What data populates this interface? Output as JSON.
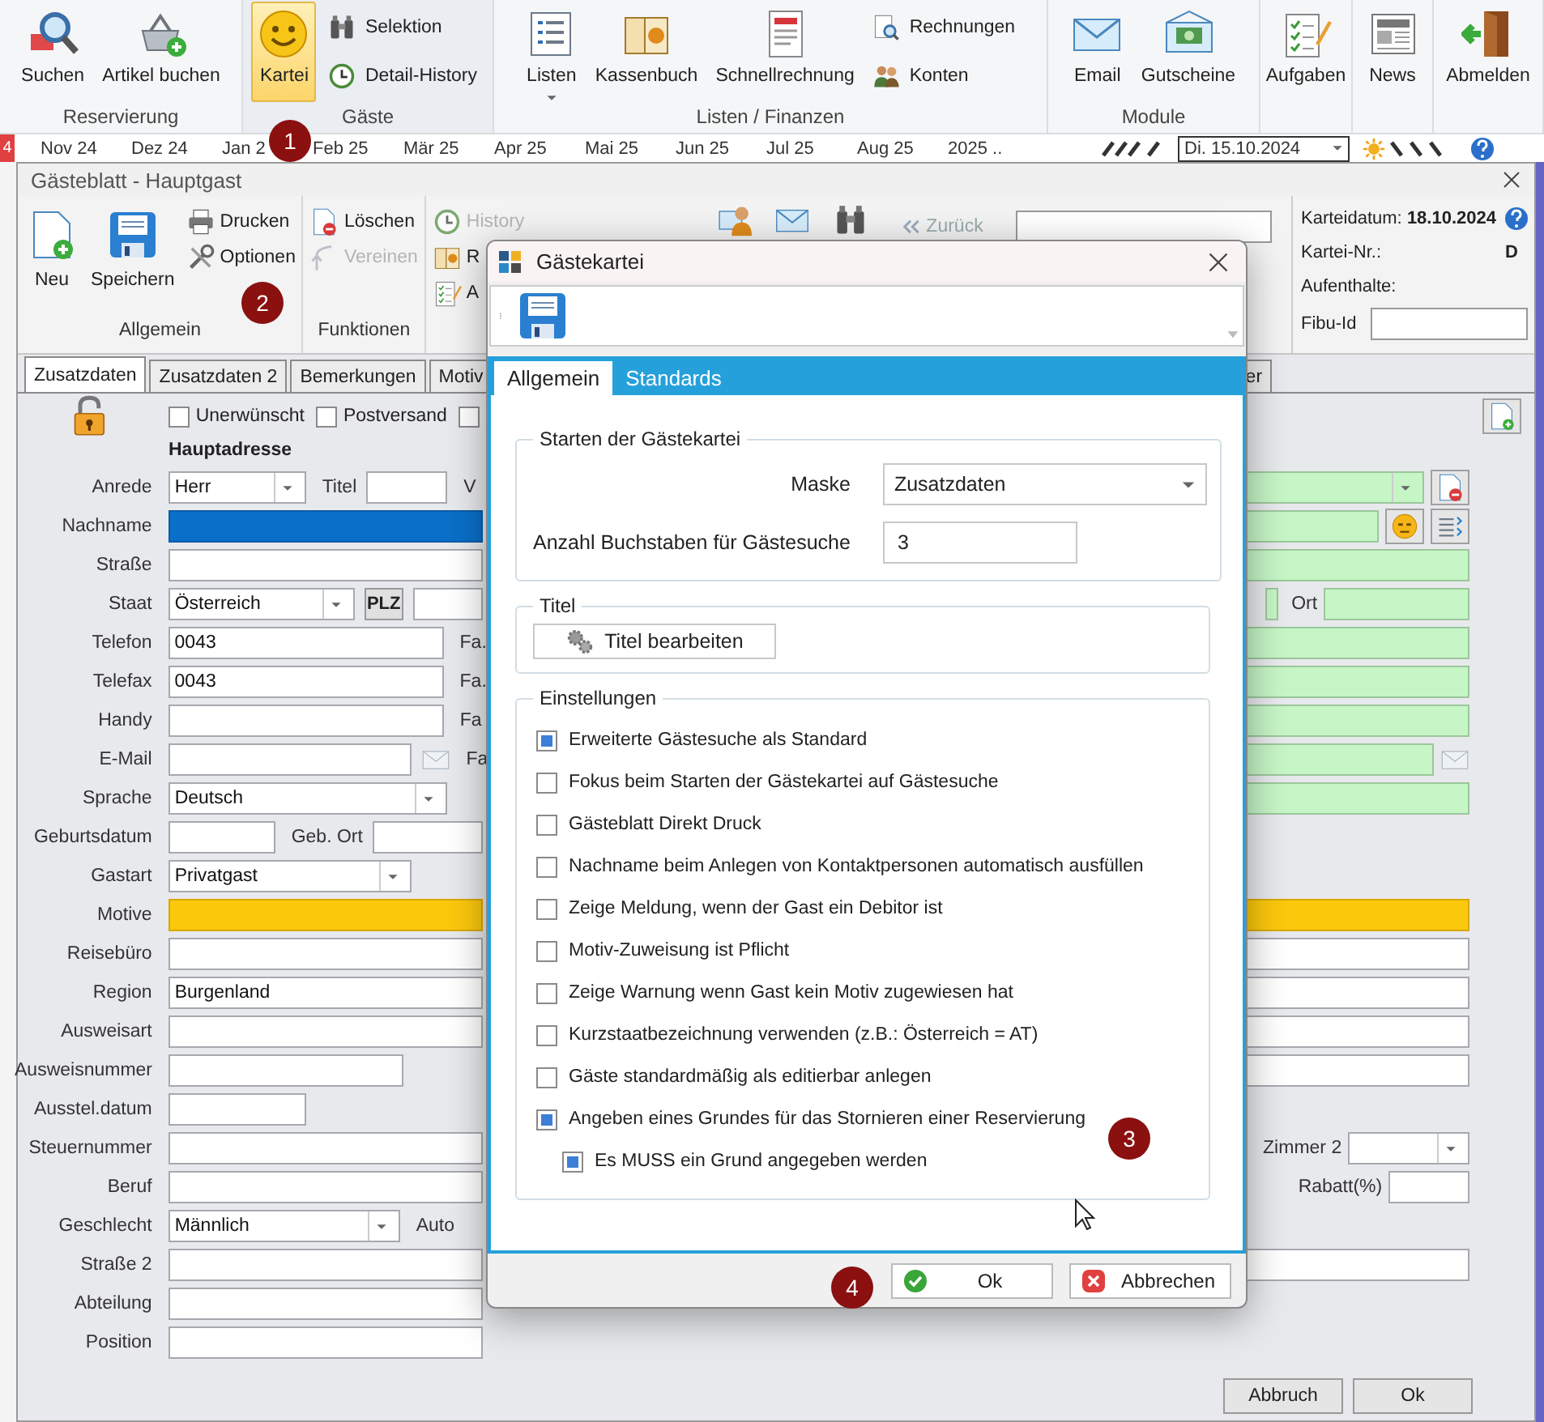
{
  "ribbon": {
    "groups": [
      {
        "label": "Reservierung",
        "items": [
          {
            "label": "Suchen",
            "kind": "large",
            "selected": false
          },
          {
            "label": "Artikel buchen",
            "kind": "large",
            "selected": false
          }
        ]
      },
      {
        "label": "Gäste",
        "items": [
          {
            "label": "Kartei",
            "kind": "large",
            "selected": true
          },
          {
            "label": "Selektion",
            "kind": "small",
            "selected": false
          },
          {
            "label": "Detail-History",
            "kind": "small",
            "selected": false
          }
        ]
      },
      {
        "label": "Listen / Finanzen",
        "items": [
          {
            "label": "Listen",
            "kind": "menu",
            "selected": false
          },
          {
            "label": "Kassenbuch",
            "kind": "large",
            "selected": false
          },
          {
            "label": "Schnellrechnung",
            "kind": "large",
            "selected": false
          },
          {
            "label": "Rechnungen",
            "kind": "small",
            "selected": false
          },
          {
            "label": "Konten",
            "kind": "small",
            "selected": false
          }
        ]
      },
      {
        "label": "Module",
        "items": [
          {
            "label": "Email",
            "kind": "large",
            "selected": false
          },
          {
            "label": "Gutscheine",
            "kind": "large",
            "selected": false
          }
        ]
      },
      {
        "items": [
          {
            "label": "Aufgaben",
            "kind": "large",
            "selected": false
          }
        ]
      },
      {
        "items": [
          {
            "label": "News",
            "kind": "large",
            "selected": false
          }
        ]
      },
      {
        "items": [
          {
            "label": "Abmelden",
            "kind": "large",
            "selected": false
          }
        ]
      }
    ]
  },
  "timeline": {
    "marker": "4",
    "months": [
      "Nov 24",
      "Dez 24",
      "Jan 2",
      "Feb 25",
      "Mär 25",
      "Apr 25",
      "Mai 25",
      "Jun 25",
      "Jul 25",
      "Aug 25",
      "2025 .."
    ],
    "date": "Di. 15.10.2024"
  },
  "window": {
    "title": "Gästeblatt - Hauptgast",
    "toolbar": {
      "groups": [
        {
          "label": "Allgemein",
          "items": [
            {
              "label": "Neu",
              "kind": "large",
              "disabled": false
            },
            {
              "label": "Speichern",
              "kind": "large",
              "disabled": false
            },
            {
              "label": "Drucken",
              "kind": "small",
              "disabled": false
            },
            {
              "label": "Optionen",
              "kind": "small",
              "disabled": false
            }
          ]
        },
        {
          "label": "Funktionen",
          "items": [
            {
              "label": "Löschen",
              "kind": "small",
              "disabled": false
            },
            {
              "label": "Vereinen",
              "kind": "small",
              "disabled": true
            }
          ]
        },
        {
          "items": [
            {
              "label": "History",
              "kind": "small",
              "disabled": true
            },
            {
              "label": "R",
              "kind": "small",
              "disabled": false
            },
            {
              "label": "A",
              "kind": "small",
              "disabled": false
            }
          ]
        }
      ]
    },
    "nav": {
      "back": "Zurück",
      "back_disabled": true
    },
    "info": {
      "date_label": "Karteidatum:",
      "date": "18.10.2024",
      "number_label": "Kartei-Nr.:",
      "number": "D",
      "stays_label": "Aufenthalte:",
      "fibu_label": "Fibu-Id"
    },
    "tabs": [
      {
        "label": "Zusatzdaten",
        "selected": true
      },
      {
        "label": "Zusatzdaten 2",
        "selected": false
      },
      {
        "label": "Bemerkungen",
        "selected": false
      },
      {
        "label": "Motiv",
        "selected": false
      },
      {
        "label": "er",
        "selected": false
      }
    ],
    "form": {
      "rows": [
        {
          "kind": "checkboxes",
          "items": [
            {
              "label": "Unerwünscht",
              "checked": false
            },
            {
              "label": "Postversand",
              "checked": false
            },
            {
              "checked": false
            }
          ]
        },
        {
          "kind": "heading",
          "text": "Hauptadresse"
        },
        {
          "kind": "field",
          "label": "Anrede",
          "left": [
            {
              "kind": "select",
              "value": "Herr"
            },
            {
              "kind": "label",
              "text": "Titel"
            },
            {
              "kind": "input"
            },
            {
              "kind": "label",
              "text": "V"
            }
          ],
          "right": [
            {
              "kind": "select",
              "required": true
            },
            {
              "kind": "delete"
            }
          ]
        },
        {
          "kind": "field",
          "label": "Nachname",
          "left": [
            {
              "kind": "input",
              "focused": true
            }
          ],
          "right": [
            {
              "kind": "input",
              "required": true
            },
            {
              "kind": "face"
            },
            {
              "kind": "list"
            }
          ]
        },
        {
          "kind": "field",
          "label": "Straße",
          "left": [
            {
              "kind": "input"
            }
          ],
          "right": [
            {
              "kind": "input",
              "required": true
            }
          ]
        },
        {
          "kind": "field",
          "label": "Staat",
          "left": [
            {
              "kind": "select",
              "value": "Österreich"
            },
            {
              "kind": "button",
              "text": "PLZ"
            },
            {
              "kind": "input"
            }
          ],
          "right": [
            {
              "kind": "input",
              "required": true
            },
            {
              "kind": "label",
              "text": "Ort"
            },
            {
              "kind": "input",
              "required": true
            }
          ]
        },
        {
          "kind": "field",
          "label": "Telefon",
          "left": [
            {
              "kind": "input",
              "value": "0043"
            },
            {
              "kind": "label",
              "text": "Fa."
            }
          ],
          "right": [
            {
              "kind": "input",
              "required": true
            }
          ]
        },
        {
          "kind": "field",
          "label": "Telefax",
          "left": [
            {
              "kind": "input",
              "value": "0043"
            },
            {
              "kind": "label",
              "text": "Fa."
            }
          ],
          "right": [
            {
              "kind": "input",
              "required": true
            }
          ]
        },
        {
          "kind": "field",
          "label": "Handy",
          "left": [
            {
              "kind": "input"
            },
            {
              "kind": "label",
              "text": "Fa"
            }
          ],
          "right": [
            {
              "kind": "input",
              "required": true
            }
          ]
        },
        {
          "kind": "field",
          "label": "E-Mail",
          "left": [
            {
              "kind": "input"
            },
            {
              "kind": "mail"
            },
            {
              "kind": "label",
              "text": "Fa"
            }
          ],
          "right": [
            {
              "kind": "input",
              "required": true
            },
            {
              "kind": "mail"
            }
          ]
        },
        {
          "kind": "field",
          "label": "Sprache",
          "left": [
            {
              "kind": "select",
              "value": "Deutsch"
            }
          ],
          "right": [
            {
              "kind": "input",
              "required": true
            }
          ]
        },
        {
          "kind": "field",
          "label": "Geburtsdatum",
          "left": [
            {
              "kind": "input"
            },
            {
              "kind": "label",
              "text": "Geb. Ort"
            },
            {
              "kind": "input"
            }
          ]
        },
        {
          "kind": "field",
          "label": "Gastart",
          "left": [
            {
              "kind": "select",
              "value": "Privatgast"
            }
          ]
        },
        {
          "kind": "field",
          "label": "Motive",
          "left": [
            {
              "kind": "input",
              "highlighted": true
            }
          ],
          "right": [
            {
              "kind": "input",
              "highlighted": true
            }
          ]
        },
        {
          "kind": "field",
          "label": "Reisebüro",
          "left": [
            {
              "kind": "input"
            }
          ],
          "right": [
            {
              "kind": "input"
            }
          ]
        },
        {
          "kind": "field",
          "label": "Region",
          "left": [
            {
              "kind": "input",
              "value": "Burgenland"
            }
          ],
          "right": [
            {
              "kind": "input"
            }
          ]
        },
        {
          "kind": "field",
          "label": "Ausweisart",
          "left": [
            {
              "kind": "input"
            }
          ],
          "right": [
            {
              "kind": "input"
            }
          ]
        },
        {
          "kind": "field",
          "label": "Ausweisnummer",
          "left": [
            {
              "kind": "input"
            }
          ],
          "right": [
            {
              "kind": "input"
            }
          ]
        },
        {
          "kind": "field",
          "label": "Ausstel.datum",
          "left": [
            {
              "kind": "input"
            }
          ]
        },
        {
          "kind": "field",
          "label": "Steuernummer",
          "left": [
            {
              "kind": "input"
            }
          ],
          "right": [
            {
              "kind": "label",
              "text": "Zimmer 2"
            },
            {
              "kind": "select"
            }
          ]
        },
        {
          "kind": "field",
          "label": "Beruf",
          "left": [
            {
              "kind": "input"
            }
          ],
          "right": [
            {
              "kind": "label",
              "text": "Rabatt(%)"
            },
            {
              "kind": "input"
            }
          ]
        },
        {
          "kind": "field",
          "label": "Geschlecht",
          "left": [
            {
              "kind": "select",
              "value": "Männlich"
            },
            {
              "kind": "label",
              "text": "Auto"
            }
          ]
        },
        {
          "kind": "field",
          "label": "Straße 2",
          "left": [
            {
              "kind": "input"
            }
          ],
          "right": [
            {
              "kind": "input"
            }
          ]
        },
        {
          "kind": "field",
          "label": "Abteilung",
          "left": [
            {
              "kind": "input"
            }
          ]
        },
        {
          "kind": "field",
          "label": "Position",
          "left": [
            {
              "kind": "input"
            }
          ]
        }
      ]
    },
    "buttons": [
      "Abbruch",
      "Ok"
    ]
  },
  "dialog": {
    "title": "Gästekartei",
    "tabs": [
      {
        "label": "Allgemein",
        "selected": true
      },
      {
        "label": "Standards",
        "selected": false
      }
    ],
    "start_group": {
      "title": "Starten der Gästekartei",
      "mask_label": "Maske",
      "mask_value": "Zusatzdaten",
      "letters_label": "Anzahl Buchstaben für Gästesuche",
      "letters_value": "3"
    },
    "title_group": {
      "title": "Titel",
      "button": "Titel bearbeiten"
    },
    "settings": {
      "title": "Einstellungen",
      "items": [
        {
          "label": "Erweiterte Gästesuche als Standard",
          "checked": true
        },
        {
          "label": "Fokus beim Starten der Gästekartei auf Gästesuche",
          "checked": false
        },
        {
          "label": "Gästeblatt Direkt Druck",
          "checked": false
        },
        {
          "label": "Nachname beim Anlegen von Kontaktpersonen automatisch ausfüllen",
          "checked": false
        },
        {
          "label": "Zeige Meldung, wenn der Gast ein Debitor ist",
          "checked": false
        },
        {
          "label": "Motiv-Zuweisung ist Pflicht",
          "checked": false
        },
        {
          "label": "Zeige Warnung wenn Gast kein Motiv zugewiesen hat",
          "checked": false
        },
        {
          "label": "Kurzstaatbezeichnung verwenden (z.B.: Österreich = AT)",
          "checked": false
        },
        {
          "label": "Gäste standardmäßig als editierbar anlegen",
          "checked": false
        },
        {
          "label": "Angeben eines Grundes für das Stornieren einer Reservierung",
          "checked": true,
          "children": [
            {
              "label": "Es MUSS ein Grund angegeben werden",
              "checked": true
            }
          ]
        }
      ]
    },
    "buttons": [
      {
        "label": "Ok",
        "kind": "ok"
      },
      {
        "label": "Abbrechen",
        "kind": "cancel"
      }
    ]
  },
  "badges": [
    "1",
    "2",
    "3",
    "4"
  ]
}
